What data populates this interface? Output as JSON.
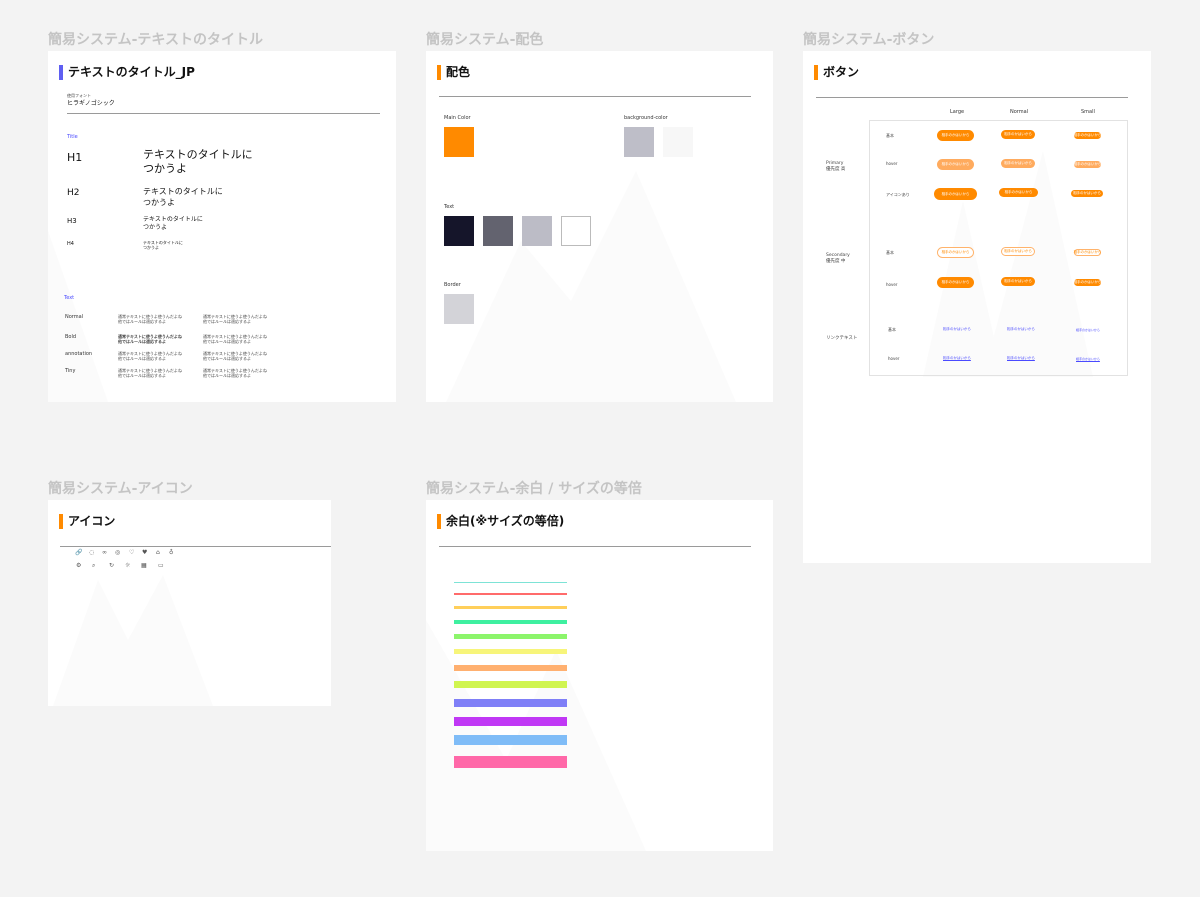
{
  "frames": {
    "text": {
      "label": "簡易システム-テキストのタイトル",
      "title": "テキストのタイトル_JP",
      "font_caption": "使用フォント",
      "font_name": "ヒラギノゴシック",
      "title_section": "Title",
      "headings": [
        {
          "label": "H1",
          "text": "テキストのタイトルに\nつかうよ"
        },
        {
          "label": "H2",
          "text": "テキストのタイトルに\nつかうよ"
        },
        {
          "label": "H3",
          "text": "テキストのタイトルに\nつかうよ"
        },
        {
          "label": "H4",
          "text": "テキストのタイトルに\nつかうよ"
        }
      ],
      "text_section": "Text",
      "text_rows": [
        {
          "label": "Normal",
          "sample1": "通常テキストに使うよ使うんだよね\n他ではルールは適応するよ",
          "sample2": "通常テキストに使うよ使うんだよね\n他ではルールは適応するよ"
        },
        {
          "label": "Bold",
          "sample1": "通常テキストに使うよ使うんだよね\n他ではルールは適応するよ",
          "sample2": "通常テキストに使うよ使うんだよね\n他ではルールは適応するよ"
        },
        {
          "label": "annotation",
          "sample1": "通常テキストに使うよ使うんだよね\n他ではルールは適応するよ",
          "sample2": "通常テキストに使うよ使うんだよね\n他ではルールは適応するよ"
        },
        {
          "label": "Tiny",
          "sample1": "通常テキストに使うよ使うんだよね\n他ではルールは適応するよ",
          "sample2": "通常テキストに使うよ使うんだよね\n他ではルールは適応するよ"
        }
      ]
    },
    "color": {
      "label": "簡易システム-配色",
      "title": "配色",
      "main_label": "Main Color",
      "bg_label": "background-color",
      "text_label": "Text",
      "border_label": "Border",
      "main_colors": [
        "#ff8a00"
      ],
      "bg_colors": [
        "#bebec8",
        "#f7f7f7"
      ],
      "text_colors": [
        "#15152a",
        "#63636f",
        "#bcbcc6",
        "#ffffff"
      ],
      "border_colors": [
        "#d3d3d8"
      ]
    },
    "button": {
      "label": "簡易システム-ボタン",
      "title": "ボタン",
      "sizes": [
        "Large",
        "Normal",
        "Small"
      ],
      "groups": [
        {
          "name": "Primary\n優先度 高",
          "states": [
            "基本",
            "hover",
            "アイコンあり"
          ]
        },
        {
          "name": "Secondary\n優先度 中",
          "states": [
            "基本",
            "hover"
          ]
        },
        {
          "name": "リンクテキスト",
          "states": [
            "基本",
            "hover"
          ]
        }
      ],
      "button_text": "相手のかはいから",
      "icon_button_text": "相手のかはいから",
      "link_text": "相手のかはいから",
      "accent": "#ff8a00",
      "hover_accent": "#ffab5e",
      "link_color": "#4a4aff"
    },
    "icon": {
      "label": "簡易システム-アイコン",
      "title": "アイコン",
      "icons_row1": [
        "link-icon",
        "globe-icon",
        "glasses-icon",
        "settings-icon",
        "heart-outline-icon",
        "heart-icon",
        "home-icon",
        "bulb-icon"
      ],
      "icons_row2": [
        "gear-icon",
        "search-icon",
        "refresh-icon",
        "sun-icon",
        "calendar-icon",
        "folder-icon"
      ]
    },
    "spacing": {
      "label": "簡易システム-余白 / サイズの等倍",
      "title": "余白(※サイズの等倍)",
      "bars": [
        {
          "color": "#7de3d6",
          "size": 1
        },
        {
          "color": "#ff6b6b",
          "size": 2
        },
        {
          "color": "#ffcf5a",
          "size": 3
        },
        {
          "color": "#3ef0a0",
          "size": 4
        },
        {
          "color": "#8cf56b",
          "size": 5
        },
        {
          "color": "#f7f57a",
          "size": 5
        },
        {
          "color": "#ffb070",
          "size": 6
        },
        {
          "color": "#d0f550",
          "size": 7
        },
        {
          "color": "#7f7ff7",
          "size": 8
        },
        {
          "color": "#c038f5",
          "size": 9
        },
        {
          "color": "#7fbcf7",
          "size": 10
        },
        {
          "color": "#ff68a8",
          "size": 12
        }
      ]
    }
  }
}
